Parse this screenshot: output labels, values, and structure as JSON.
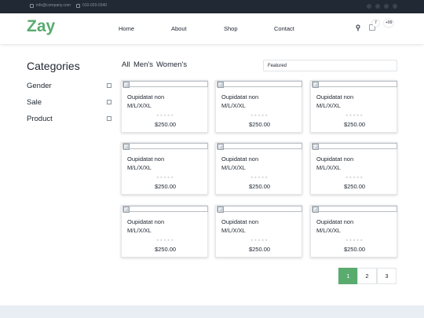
{
  "topbar": {
    "email": "info@company.com",
    "phone": "010-020-0340"
  },
  "nav": {
    "logo": "Zay",
    "links": [
      "Home",
      "About",
      "Shop",
      "Contact"
    ],
    "cart_count": "7",
    "user_count": "+99"
  },
  "sidebar": {
    "title": "Categories",
    "items": [
      "Gender",
      "Sale",
      "Product"
    ]
  },
  "filters": {
    "tabs": [
      "All",
      "Men's",
      "Women's"
    ],
    "sort_value": "Featured"
  },
  "products": [
    {
      "name": "Oupidatat non",
      "sizes": "M/L/X/XL",
      "price": "$250.00",
      "rating": 0
    },
    {
      "name": "Oupidatat non",
      "sizes": "M/L/X/XL",
      "price": "$250.00",
      "rating": 0
    },
    {
      "name": "Oupidatat non",
      "sizes": "M/L/X/XL",
      "price": "$250.00",
      "rating": 0
    },
    {
      "name": "Oupidatat non",
      "sizes": "M/L/X/XL",
      "price": "$250.00",
      "rating": 0
    },
    {
      "name": "Oupidatat non",
      "sizes": "M/L/X/XL",
      "price": "$250.00",
      "rating": 0
    },
    {
      "name": "Oupidatat non",
      "sizes": "M/L/X/XL",
      "price": "$250.00",
      "rating": 0
    },
    {
      "name": "Oupidatat non",
      "sizes": "M/L/X/XL",
      "price": "$250.00",
      "rating": 0
    },
    {
      "name": "Oupidatat non",
      "sizes": "M/L/X/XL",
      "price": "$250.00",
      "rating": 0
    },
    {
      "name": "Oupidatat non",
      "sizes": "M/L/X/XL",
      "price": "$250.00",
      "rating": 0
    }
  ],
  "pagination": {
    "pages": [
      "1",
      "2",
      "3"
    ],
    "active": "1"
  },
  "colors": {
    "brand": "#59ab6e",
    "topbar": "#212934"
  }
}
